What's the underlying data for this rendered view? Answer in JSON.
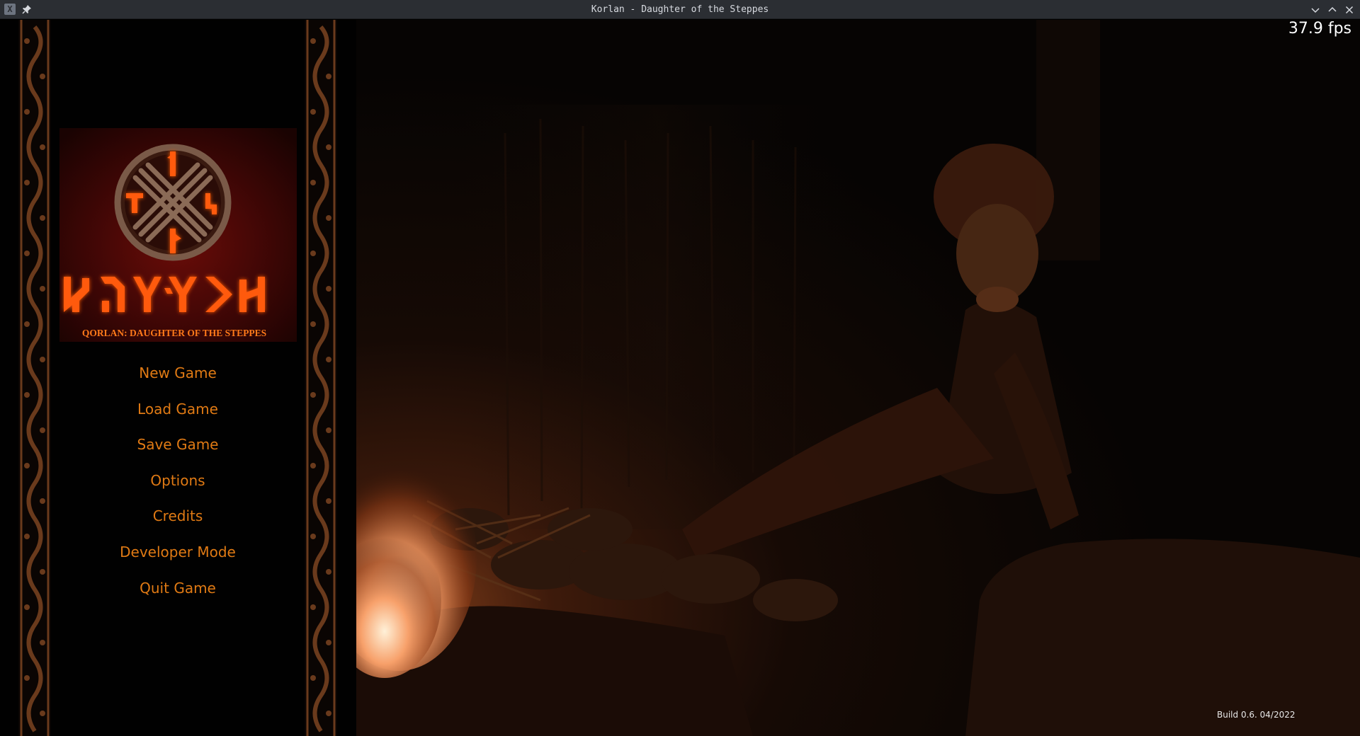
{
  "window": {
    "title": "Korlan - Daughter of the Steppes",
    "icons": [
      "app-icon",
      "pin-icon",
      "minimize-icon",
      "maximize-icon",
      "close-icon"
    ]
  },
  "overlay": {
    "fps": "37.9 fps",
    "build": "Build 0.6. 04/2022"
  },
  "logo": {
    "runic_title": "𐰴𐰆𐰺𐰞𐰀𐰣",
    "subtitle": "QORLAN: DAUGHTER OF THE STEPPES"
  },
  "menu": {
    "items": [
      {
        "label": "New Game"
      },
      {
        "label": "Load Game"
      },
      {
        "label": "Save Game"
      },
      {
        "label": "Options"
      },
      {
        "label": "Credits"
      },
      {
        "label": "Developer Mode"
      },
      {
        "label": "Quit Game"
      }
    ]
  },
  "colors": {
    "menu_text": "#e07a14",
    "ornament": "#6a3a1c",
    "rune_glow": "#ff5a0a",
    "logo_bg": "#3a0605",
    "titlebar": "#2b2e33"
  }
}
